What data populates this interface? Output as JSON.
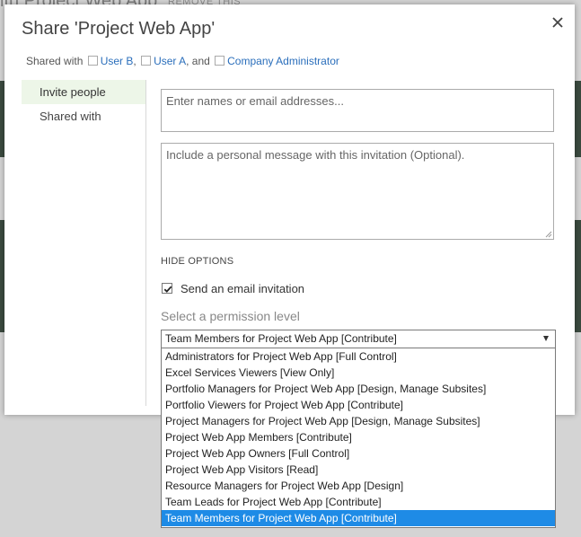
{
  "background": {
    "title_fragment": "ith Project Web App",
    "remove_link": "REMOVE THIS"
  },
  "dialog": {
    "title": "Share 'Project Web App'",
    "shared_with_prefix": "Shared with",
    "shared_users": [
      "User B",
      "User A"
    ],
    "and_text": "and",
    "shared_group": "Company Administrator",
    "close_icon": "close-icon"
  },
  "nav": {
    "items": [
      {
        "label": "Invite people",
        "active": true
      },
      {
        "label": "Shared with",
        "active": false
      }
    ]
  },
  "form": {
    "names_placeholder": "Enter names or email addresses...",
    "message_placeholder": "Include a personal message with this invitation (Optional).",
    "hide_options": "HIDE OPTIONS",
    "send_email_label": "Send an email invitation",
    "send_email_checked": true,
    "permission_label": "Select a permission level",
    "permission_selected": "Team Members for Project Web App [Contribute]",
    "permission_options": [
      "Administrators for Project Web App [Full Control]",
      "Excel Services Viewers [View Only]",
      "Portfolio Managers for Project Web App [Design, Manage Subsites]",
      "Portfolio Viewers for Project Web App [Contribute]",
      "Project Managers for Project Web App [Design, Manage Subsites]",
      "Project Web App Members [Contribute]",
      "Project Web App Owners [Full Control]",
      "Project Web App Visitors [Read]",
      "Resource Managers for Project Web App [Design]",
      "Team Leads for Project Web App [Contribute]",
      "Team Members for Project Web App [Contribute]"
    ],
    "highlight_color": "#1e8be6"
  }
}
